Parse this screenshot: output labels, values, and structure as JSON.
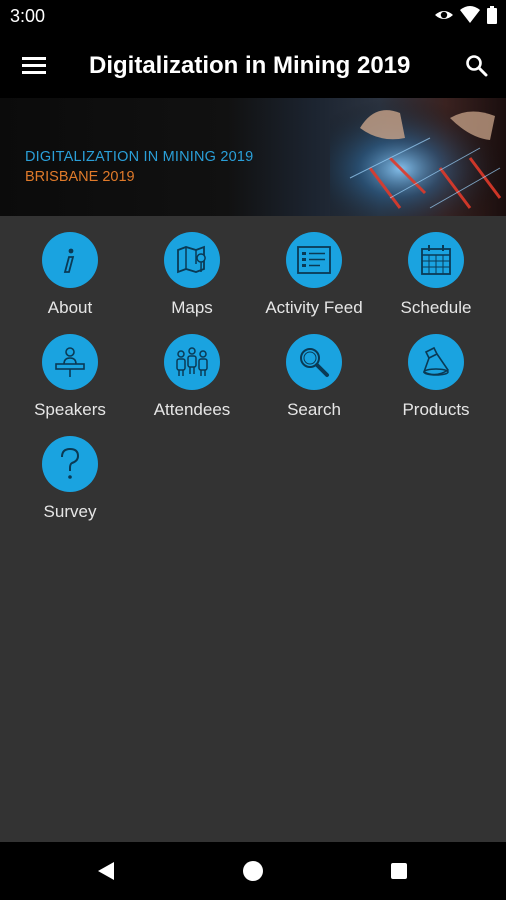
{
  "status_bar": {
    "time": "3:00"
  },
  "app_bar": {
    "title": "Digitalization in Mining 2019"
  },
  "banner": {
    "line1": "DIGITALIZATION IN MINING 2019",
    "line2": "BRISBANE 2019"
  },
  "colors": {
    "accent": "#1aa3e0",
    "background": "#333333",
    "bar": "#000000",
    "banner_blue": "#2a9fd8",
    "banner_orange": "#e07a2a"
  },
  "tiles": [
    {
      "label": "About",
      "icon": "info-icon"
    },
    {
      "label": "Maps",
      "icon": "map-icon"
    },
    {
      "label": "Activity Feed",
      "icon": "activity-feed-icon"
    },
    {
      "label": "Schedule",
      "icon": "calendar-icon"
    },
    {
      "label": "Speakers",
      "icon": "speaker-icon"
    },
    {
      "label": "Attendees",
      "icon": "attendees-icon"
    },
    {
      "label": "Search",
      "icon": "magnifier-icon"
    },
    {
      "label": "Products",
      "icon": "products-icon"
    },
    {
      "label": "Survey",
      "icon": "question-icon"
    }
  ]
}
